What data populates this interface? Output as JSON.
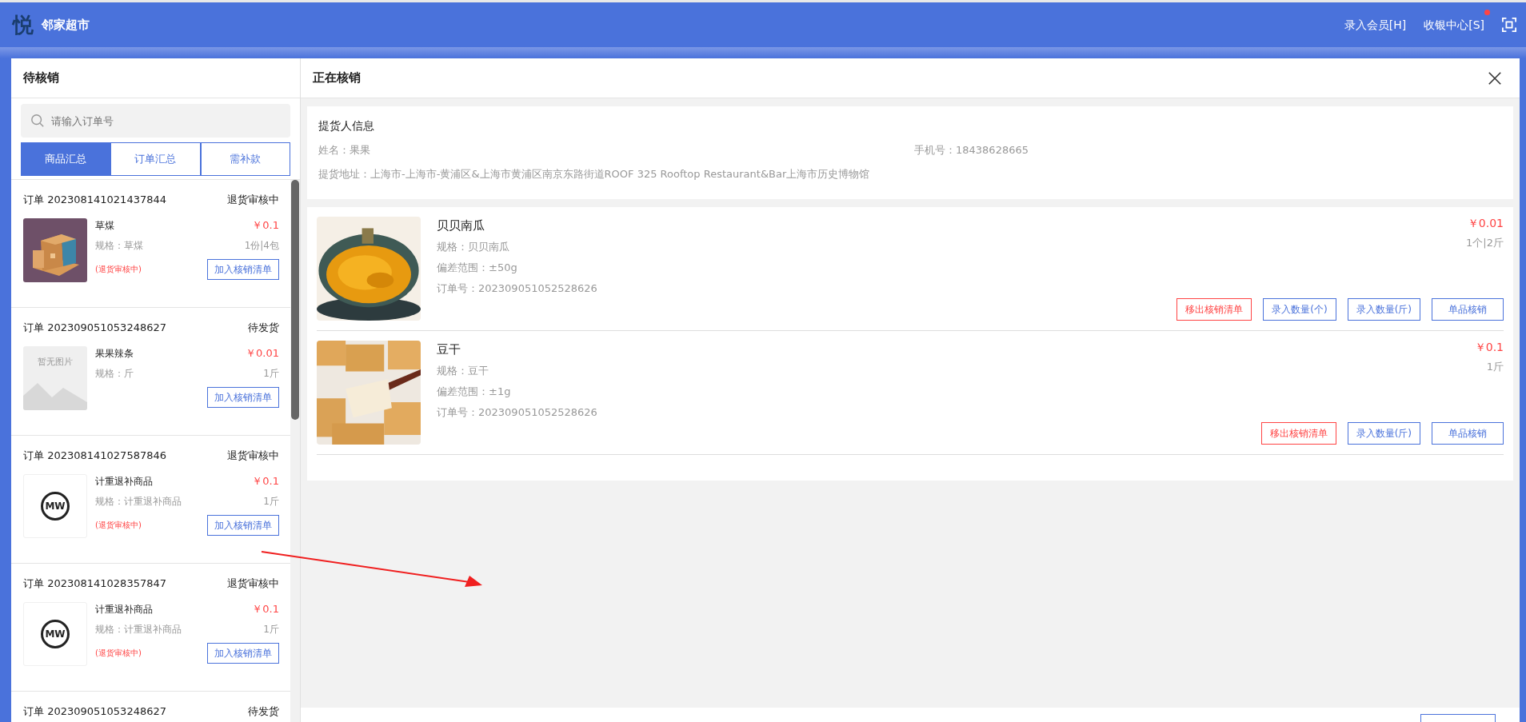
{
  "header": {
    "logo": "悦",
    "title": "邻家超市",
    "actions": [
      {
        "label": "录入会员[H]",
        "badge": false
      },
      {
        "label": "收银中心[S]",
        "badge": true
      }
    ]
  },
  "pending": {
    "title": "待核销",
    "search": {
      "placeholder": "请输入订单号"
    },
    "tabs": [
      {
        "label": "商品汇总",
        "selected": true
      },
      {
        "label": "订单汇总",
        "selected": false
      },
      {
        "label": "需补款",
        "selected": false
      }
    ],
    "orders": [
      {
        "order": "订单 202308141021437844",
        "status": "退货审核中",
        "image": {
          "kind": "picture"
        },
        "name": "草煤",
        "price": "￥0.1",
        "spec": "规格：草煤",
        "qty": "1份|4包",
        "note": "(退货审核中)",
        "button": "加入核销清单"
      },
      {
        "order": "订单 202309051053248627",
        "status": "待发货",
        "image": {
          "kind": "placeholder",
          "text": "暂无图片"
        },
        "name": "果果辣条",
        "price": "￥0.01",
        "spec": "规格：斤",
        "qty": "1斤",
        "button": "加入核销清单"
      },
      {
        "order": "订单 202308141027587846",
        "status": "退货审核中",
        "image": {
          "kind": "logo",
          "text": "MW"
        },
        "name": "计重退补商品",
        "price": "￥0.1",
        "spec": "规格：计重退补商品",
        "qty": "1斤",
        "note": "(退货审核中)",
        "button": "加入核销清单"
      },
      {
        "order": "订单 202308141028357847",
        "status": "退货审核中",
        "image": {
          "kind": "logo",
          "text": "MW"
        },
        "name": "计重退补商品",
        "price": "￥0.1",
        "spec": "规格：计重退补商品",
        "qty": "1斤",
        "note": "(退货审核中)",
        "button": "加入核销清单"
      },
      {
        "order": "订单 202309051053248627",
        "status": "待发货"
      }
    ]
  },
  "current": {
    "title": "正在核销",
    "pickup": {
      "title": "提货人信息",
      "name": "姓名：果果",
      "phone": "手机号：18438628665",
      "address": "提货地址：上海市-上海市-黄浦区&上海市黄浦区南京东路街道ROOF 325 Rooftop Restaurant&Bar上海市历史博物馆"
    },
    "items": [
      {
        "image": {
          "kind": "picture"
        },
        "name": "贝贝南瓜",
        "spec": "规格：贝贝南瓜",
        "range": "偏差范围：±50g",
        "order": "订单号：202309051052528626",
        "price": "￥0.01",
        "qty": "1个|2斤",
        "buttons": [
          {
            "label": "移出核销清单",
            "kind": "danger"
          },
          {
            "label": "录入数量(个)",
            "kind": "primary"
          },
          {
            "label": "录入数量(斤)",
            "kind": "primary"
          },
          {
            "label": "单品核销",
            "kind": "primary"
          }
        ]
      },
      {
        "image": {
          "kind": "picture"
        },
        "name": "豆干",
        "spec": "规格：豆干",
        "range": "偏差范围：±1g",
        "order": "订单号：202309051052528626",
        "price": "￥0.1",
        "qty": "1斤",
        "buttons": [
          {
            "label": "移出核销清单",
            "kind": "danger"
          },
          {
            "label": "录入数量(斤)",
            "kind": "primary"
          },
          {
            "label": "单品核销",
            "kind": "primary"
          }
        ]
      }
    ]
  }
}
